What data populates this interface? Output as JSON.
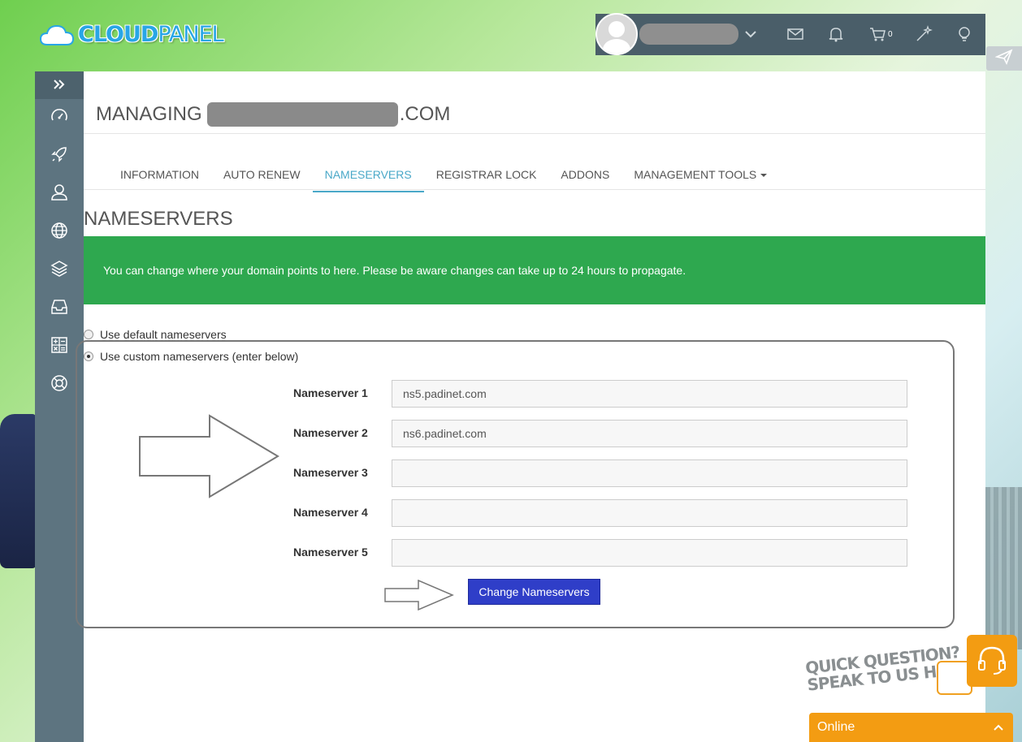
{
  "brand": {
    "logo_part1": "CLOUD",
    "logo_part2": "PANEL"
  },
  "topbar": {
    "cart_count": "0"
  },
  "page": {
    "title_prefix": "MANAGING",
    "title_suffix": ".COM",
    "tabs": [
      {
        "label": "INFORMATION"
      },
      {
        "label": "AUTO RENEW"
      },
      {
        "label": "NAMESERVERS",
        "active": true
      },
      {
        "label": "REGISTRAR LOCK"
      },
      {
        "label": "ADDONS"
      },
      {
        "label": "MANAGEMENT TOOLS"
      }
    ],
    "section_title": "NAMESERVERS",
    "alert": "You can change where your domain points to here. Please be aware changes can take up to 24 hours to propagate."
  },
  "form": {
    "option_default": "Use default nameservers",
    "option_custom": "Use custom nameservers (enter below)",
    "nameservers": [
      {
        "label": "Nameserver 1",
        "value": "ns5.padinet.com"
      },
      {
        "label": "Nameserver 2",
        "value": "ns6.padinet.com"
      },
      {
        "label": "Nameserver 3",
        "value": ""
      },
      {
        "label": "Nameserver 4",
        "value": ""
      },
      {
        "label": "Nameserver 5",
        "value": ""
      }
    ],
    "submit_label": "Change Nameservers"
  },
  "chat": {
    "promo_line1": "QUICK QUESTION?",
    "promo_line2": "SPEAK TO US HERE!",
    "status": "Online"
  },
  "colors": {
    "accent": "#4aa8c8",
    "alert_green": "#2ea84f",
    "sidebar": "#5d7480",
    "button": "#2f3ec8",
    "chat": "#f39c12"
  }
}
